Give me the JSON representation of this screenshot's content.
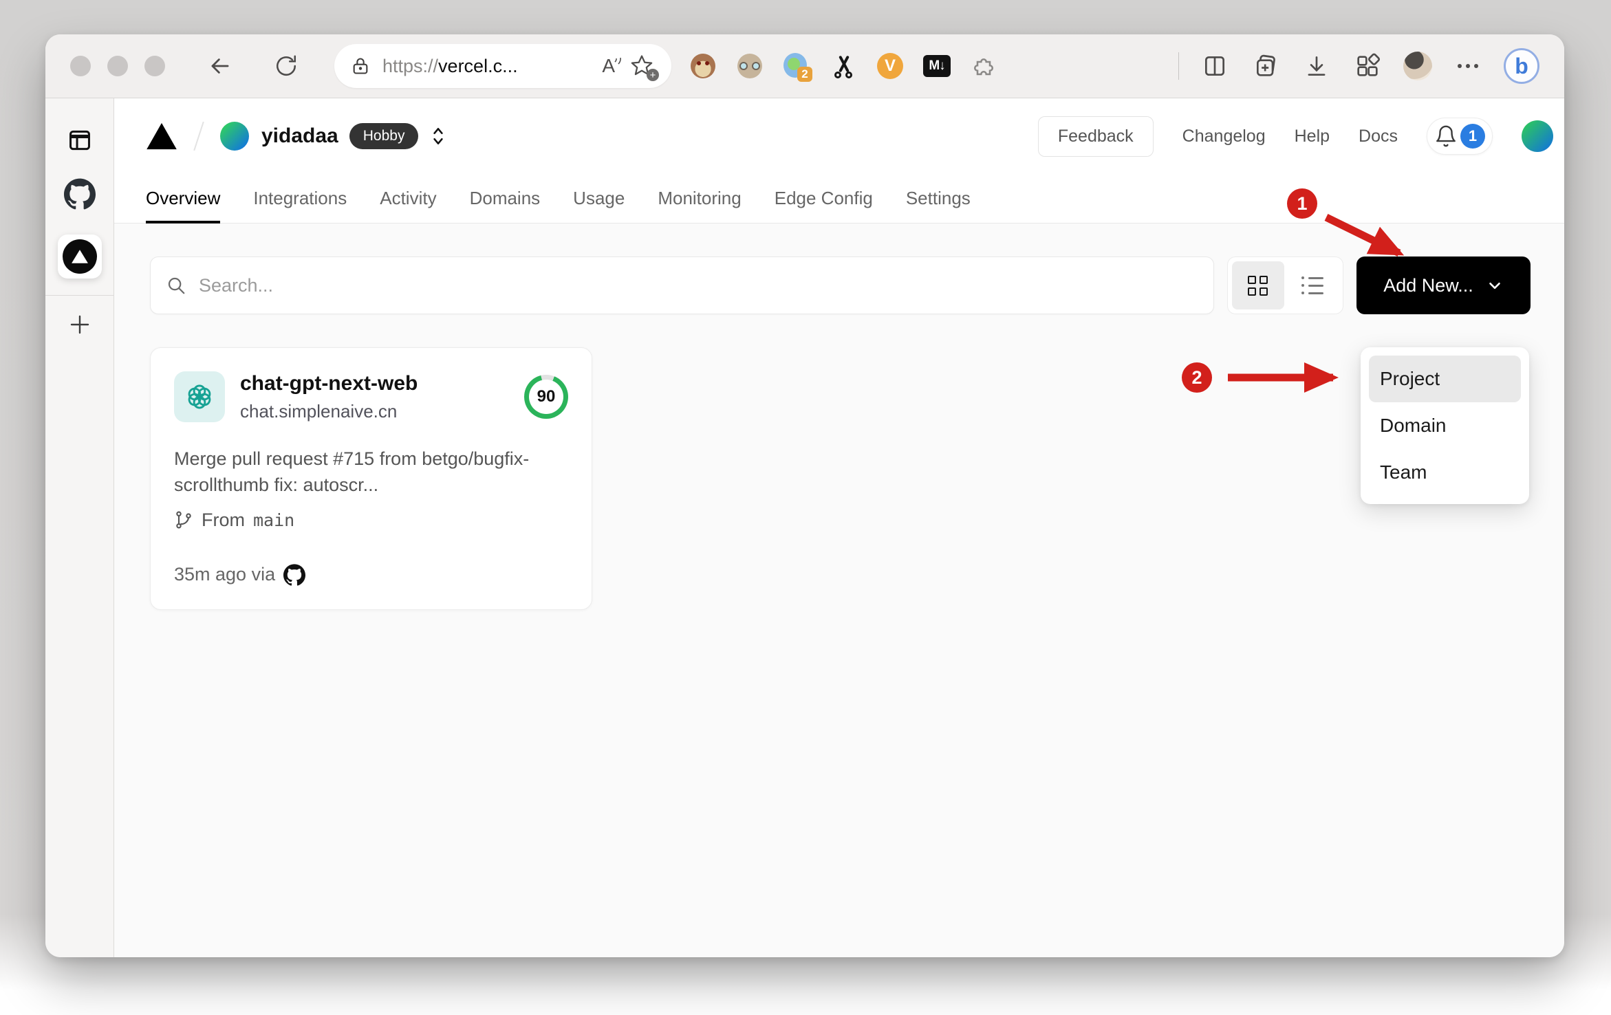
{
  "browser": {
    "url_scheme": "https://",
    "url_host": "vercel.c...",
    "read_aloud_label": "A",
    "extensions": {
      "translate_badge": "2",
      "v_label": "V",
      "markdown_label": "M↓"
    },
    "bing_label": "b"
  },
  "vercel_header": {
    "team_name": "yidadaa",
    "plan_badge": "Hobby",
    "feedback_label": "Feedback",
    "links": [
      {
        "label": "Changelog"
      },
      {
        "label": "Help"
      },
      {
        "label": "Docs"
      }
    ],
    "notification_count": "1"
  },
  "nav_tabs": [
    {
      "label": "Overview",
      "active": true
    },
    {
      "label": "Integrations"
    },
    {
      "label": "Activity"
    },
    {
      "label": "Domains"
    },
    {
      "label": "Usage"
    },
    {
      "label": "Monitoring"
    },
    {
      "label": "Edge Config"
    },
    {
      "label": "Settings"
    }
  ],
  "content_toolbar": {
    "search_placeholder": "Search...",
    "add_new_label": "Add New..."
  },
  "add_new_dropdown": {
    "items": [
      {
        "label": "Project",
        "highlighted": true
      },
      {
        "label": "Domain"
      },
      {
        "label": "Team"
      }
    ]
  },
  "project_card": {
    "name": "chat-gpt-next-web",
    "domain": "chat.simplenaive.cn",
    "score": "90",
    "commit_message": "Merge pull request #715 from betgo/bugfix-scrollthumb fix: autoscr...",
    "branch_label": "From",
    "branch_name": "main",
    "deploy_meta": "35m ago via"
  },
  "annotations": [
    {
      "number": "1"
    },
    {
      "number": "2"
    }
  ],
  "colors": {
    "annotation_red": "#d2201b",
    "score_green": "#2bb45a",
    "notification_blue": "#2a7de1",
    "add_new_bg": "#000000"
  }
}
